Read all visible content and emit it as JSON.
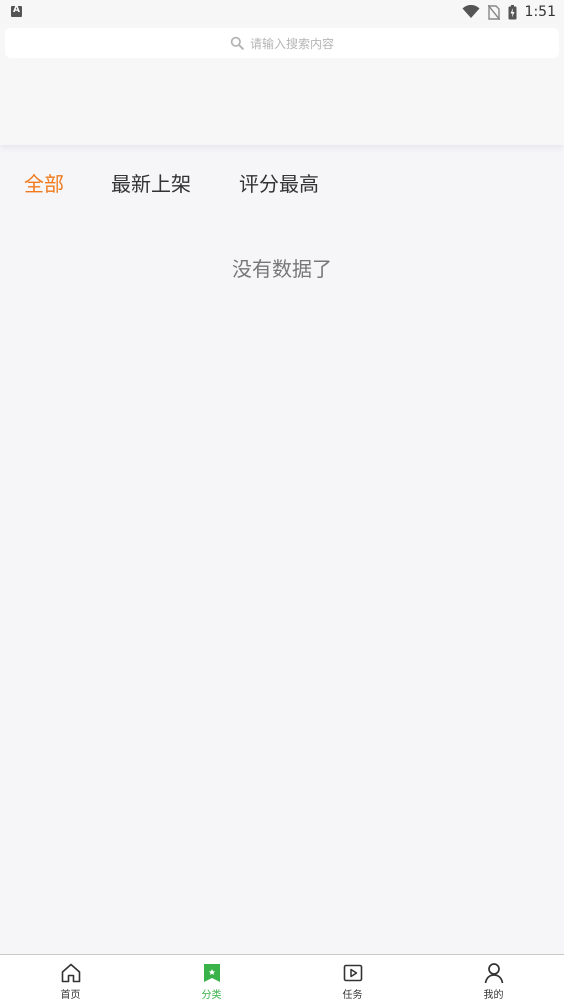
{
  "status_bar": {
    "time": "1:51",
    "left_icon": "app-notification-icon",
    "icons": [
      "wifi-icon",
      "no-sim-icon",
      "battery-charging-icon"
    ]
  },
  "search": {
    "placeholder": "请输入搜索内容",
    "icon": "search-icon"
  },
  "tabs": [
    {
      "label": "全部",
      "active": true
    },
    {
      "label": "最新上架",
      "active": false
    },
    {
      "label": "评分最高",
      "active": false
    }
  ],
  "empty_message": "没有数据了",
  "bottom_nav": [
    {
      "label": "首页",
      "icon": "home-icon",
      "active": false
    },
    {
      "label": "分类",
      "icon": "bookmark-icon",
      "active": true
    },
    {
      "label": "任务",
      "icon": "play-square-icon",
      "active": false
    },
    {
      "label": "我的",
      "icon": "user-icon",
      "active": false
    }
  ],
  "colors": {
    "accent": "#f07a1d",
    "nav_active": "#3ab24a",
    "background": "#f6f6f9"
  }
}
